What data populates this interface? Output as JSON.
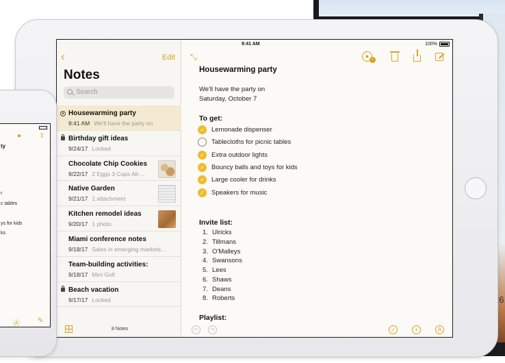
{
  "status_bar": {
    "device": "iPad",
    "time": "9:41 AM",
    "battery": "100%"
  },
  "sidebar": {
    "edit_label": "Edit",
    "title": "Notes",
    "search_placeholder": "Search",
    "notes": [
      {
        "title": "Housewarming party",
        "date": "9:41 AM",
        "preview": "We'll have the party on",
        "icon": "shared-icon",
        "selected": true
      },
      {
        "title": "Birthday gift ideas",
        "date": "9/24/17",
        "preview": "Locked",
        "icon": "lock-icon"
      },
      {
        "title": "Chocolate Chip Cookies",
        "date": "9/22/17",
        "preview": "2 Eggs 3 Cups All-...",
        "thumb": "cookie"
      },
      {
        "title": "Native Garden",
        "date": "9/21/17",
        "preview": "1 attachment",
        "thumb": "garden"
      },
      {
        "title": "Kitchen remodel ideas",
        "date": "9/20/17",
        "preview": "1 photo",
        "thumb": "wood"
      },
      {
        "title": "Miami conference notes",
        "date": "9/18/17",
        "preview": "Sales in emerging markets..."
      },
      {
        "title": "Team-building activities:",
        "date": "9/18/17",
        "preview": "Mini Golf"
      },
      {
        "title": "Beach vacation",
        "date": "9/17/17",
        "preview": "Locked",
        "icon": "lock-icon"
      }
    ],
    "note_count": "8 Notes"
  },
  "detail": {
    "title": "Housewarming party",
    "intro_line1": "We'll have the party on",
    "intro_line2": "Saturday, October 7",
    "to_get_heading": "To get:",
    "checklist": [
      {
        "text": "Lemonade dispenser",
        "checked": true
      },
      {
        "text": "Tablecloths for picnic tables",
        "checked": false
      },
      {
        "text": "Extra outdoor lights",
        "checked": true
      },
      {
        "text": "Bouncy balls and toys for kids",
        "checked": true
      },
      {
        "text": "Large cooler for drinks",
        "checked": true
      },
      {
        "text": "Speakers for music",
        "checked": true
      }
    ],
    "invite_heading": "Invite list:",
    "invite_list": [
      {
        "n": "1.",
        "name": "Ulricks"
      },
      {
        "n": "2.",
        "name": "Tillmans"
      },
      {
        "n": "3.",
        "name": "O'Malleys"
      },
      {
        "n": "4.",
        "name": "Swansons"
      },
      {
        "n": "5.",
        "name": "Lees"
      },
      {
        "n": "6.",
        "name": "Shaws"
      },
      {
        "n": "7.",
        "name": "Deans"
      },
      {
        "n": "8.",
        "name": "Roberts"
      }
    ],
    "playlist_heading": "Playlist:"
  },
  "iphone": {
    "lines": [
      "ty",
      "r",
      "c tables",
      "ys for kids",
      "ks"
    ]
  },
  "background_mac": {
    "partial_text": "26"
  },
  "colors": {
    "accent": "#d9a21b",
    "check": "#f1bb2c",
    "selection": "#f4ead1"
  }
}
